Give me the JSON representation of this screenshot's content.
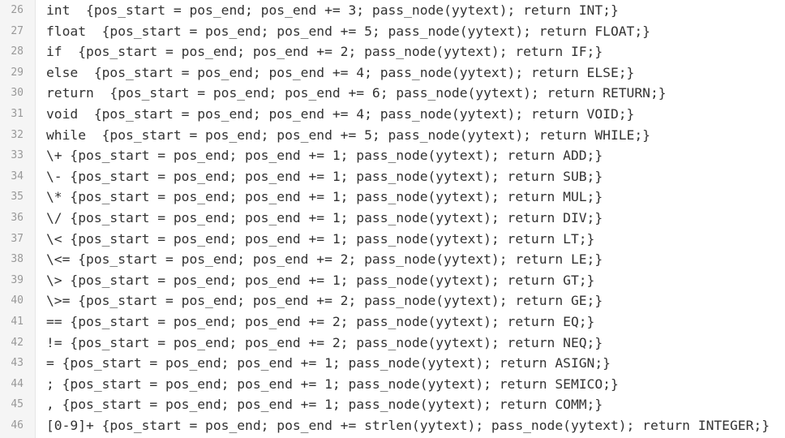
{
  "editor": {
    "lines": [
      {
        "number": "26",
        "text": "int  {pos_start = pos_end; pos_end += 3; pass_node(yytext); return INT;}"
      },
      {
        "number": "27",
        "text": "float  {pos_start = pos_end; pos_end += 5; pass_node(yytext); return FLOAT;}"
      },
      {
        "number": "28",
        "text": "if  {pos_start = pos_end; pos_end += 2; pass_node(yytext); return IF;}"
      },
      {
        "number": "29",
        "text": "else  {pos_start = pos_end; pos_end += 4; pass_node(yytext); return ELSE;}"
      },
      {
        "number": "30",
        "text": "return  {pos_start = pos_end; pos_end += 6; pass_node(yytext); return RETURN;}"
      },
      {
        "number": "31",
        "text": "void  {pos_start = pos_end; pos_end += 4; pass_node(yytext); return VOID;}"
      },
      {
        "number": "32",
        "text": "while  {pos_start = pos_end; pos_end += 5; pass_node(yytext); return WHILE;}"
      },
      {
        "number": "33",
        "text": "\\+ {pos_start = pos_end; pos_end += 1; pass_node(yytext); return ADD;}"
      },
      {
        "number": "34",
        "text": "\\- {pos_start = pos_end; pos_end += 1; pass_node(yytext); return SUB;}"
      },
      {
        "number": "35",
        "text": "\\* {pos_start = pos_end; pos_end += 1; pass_node(yytext); return MUL;}"
      },
      {
        "number": "36",
        "text": "\\/ {pos_start = pos_end; pos_end += 1; pass_node(yytext); return DIV;}"
      },
      {
        "number": "37",
        "text": "\\< {pos_start = pos_end; pos_end += 1; pass_node(yytext); return LT;}"
      },
      {
        "number": "38",
        "text": "\\<= {pos_start = pos_end; pos_end += 2; pass_node(yytext); return LE;}"
      },
      {
        "number": "39",
        "text": "\\> {pos_start = pos_end; pos_end += 1; pass_node(yytext); return GT;}"
      },
      {
        "number": "40",
        "text": "\\>= {pos_start = pos_end; pos_end += 2; pass_node(yytext); return GE;}"
      },
      {
        "number": "41",
        "text": "== {pos_start = pos_end; pos_end += 2; pass_node(yytext); return EQ;}"
      },
      {
        "number": "42",
        "text": "!= {pos_start = pos_end; pos_end += 2; pass_node(yytext); return NEQ;}"
      },
      {
        "number": "43",
        "text": "= {pos_start = pos_end; pos_end += 1; pass_node(yytext); return ASIGN;}"
      },
      {
        "number": "44",
        "text": "; {pos_start = pos_end; pos_end += 1; pass_node(yytext); return SEMICO;}"
      },
      {
        "number": "45",
        "text": ", {pos_start = pos_end; pos_end += 1; pass_node(yytext); return COMM;}"
      },
      {
        "number": "46",
        "text": "[0-9]+ {pos_start = pos_end; pos_end += strlen(yytext); pass_node(yytext); return INTEGER;}"
      }
    ]
  }
}
